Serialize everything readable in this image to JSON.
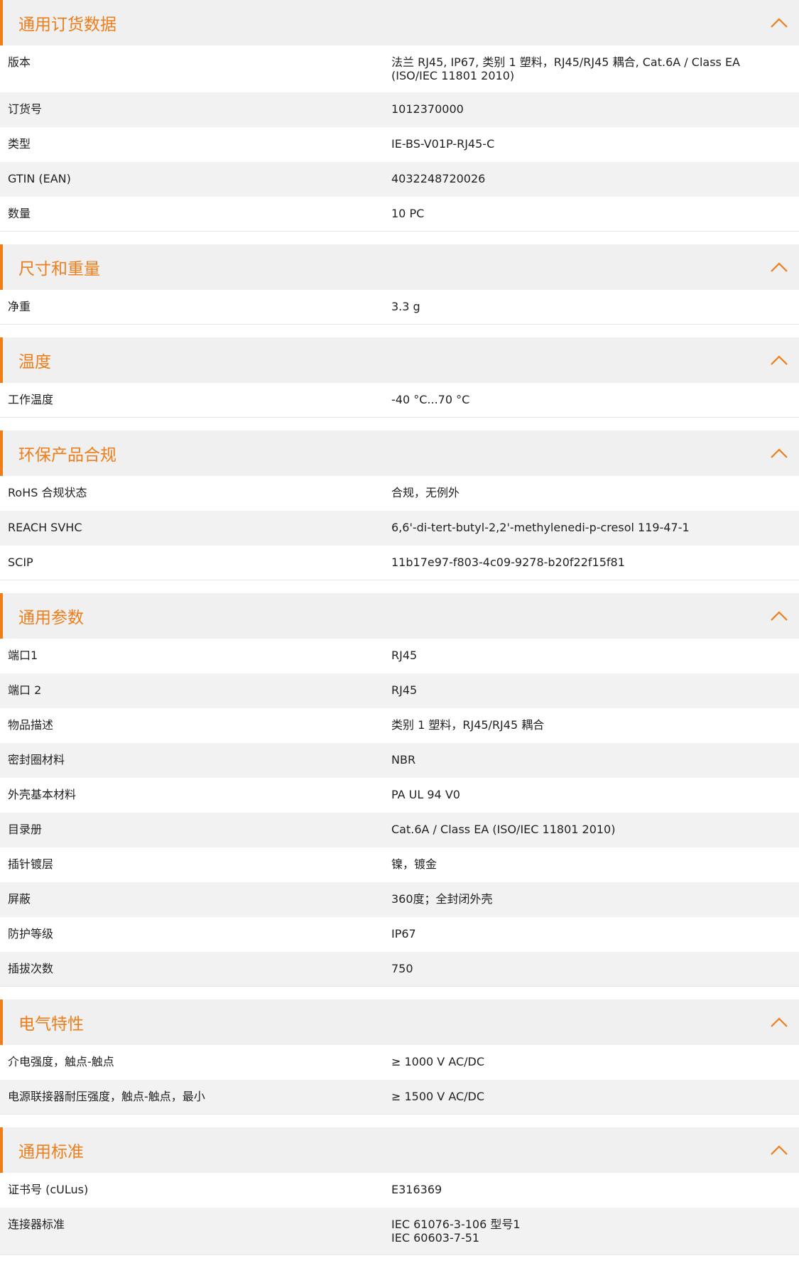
{
  "colors": {
    "accent": "#ee7d1a",
    "header_bg": "#f0f0f0",
    "row_alt": "#f2f2f2"
  },
  "icons": {
    "collapse": "chevron-up-icon"
  },
  "sections": [
    {
      "id": "ordering",
      "title": "通用订货数据",
      "rows": [
        {
          "label": "版本",
          "value": "法兰 RJ45, IP67, 类别 1 塑料，RJ45/RJ45 耦合, Cat.6A / Class EA (ISO/IEC 11801 2010)"
        },
        {
          "label": "订货号",
          "value": "1012370000"
        },
        {
          "label": "类型",
          "value": "IE-BS-V01P-RJ45-C"
        },
        {
          "label": "GTIN (EAN)",
          "value": "4032248720026"
        },
        {
          "label": "数量",
          "value": "10  PC"
        }
      ]
    },
    {
      "id": "dimensions",
      "title": "尺寸和重量",
      "rows": [
        {
          "label": "净重",
          "value": "3.3  g"
        }
      ]
    },
    {
      "id": "temperature",
      "title": "温度",
      "rows": [
        {
          "label": "工作温度",
          "value": "-40 °C...70 °C"
        }
      ]
    },
    {
      "id": "environment",
      "title": "环保产品合规",
      "rows": [
        {
          "label": "RoHS 合规状态",
          "value": "合规，无例外"
        },
        {
          "label": "REACH SVHC",
          "value": "6,6'-di-tert-butyl-2,2'-methylenedi-p-cresol 119-47-1"
        },
        {
          "label": "SCIP",
          "value": "11b17e97-f803-4c09-9278-b20f22f15f81"
        }
      ]
    },
    {
      "id": "general",
      "title": "通用参数",
      "rows": [
        {
          "label": "端口1",
          "value": "RJ45"
        },
        {
          "label": "端口 2",
          "value": "RJ45"
        },
        {
          "label": "物品描述",
          "value": "类别 1 塑料，RJ45/RJ45 耦合"
        },
        {
          "label": "密封圈材料",
          "value": "NBR"
        },
        {
          "label": "外壳基本材料",
          "value": "PA UL 94 V0"
        },
        {
          "label": "目录册",
          "value": "Cat.6A / Class EA (ISO/IEC 11801 2010)"
        },
        {
          "label": "插针镀层",
          "value": "镍，镀金"
        },
        {
          "label": "屏蔽",
          "value": "360度；全封闭外壳"
        },
        {
          "label": "防护等级",
          "value": "IP67"
        },
        {
          "label": "插拔次数",
          "value": "750"
        }
      ]
    },
    {
      "id": "electrical",
      "title": "电气特性",
      "rows": [
        {
          "label": "介电强度，触点-触点",
          "value": "≥ 1000 V AC/DC"
        },
        {
          "label": "电源联接器耐压强度，触点-触点，最小",
          "value": "≥ 1500 V AC/DC"
        }
      ]
    },
    {
      "id": "standards",
      "title": "通用标准",
      "rows": [
        {
          "label": "证书号 (cULus)",
          "value": "E316369"
        },
        {
          "label": "连接器标准",
          "value": "IEC 61076-3-106 型号1\nIEC 60603-7-51"
        }
      ]
    }
  ]
}
